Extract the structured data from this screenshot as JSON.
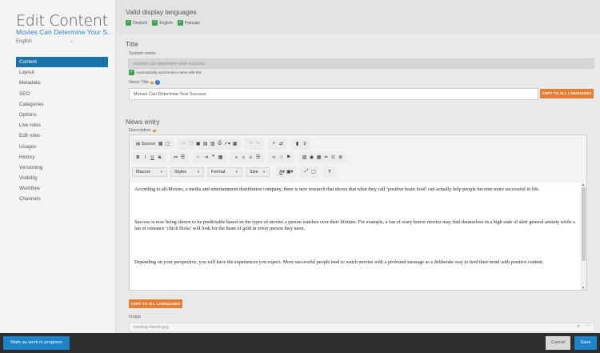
{
  "sidebar": {
    "title": "Edit Content",
    "subtitle": "Movies Can Determine Your S...",
    "language": "English",
    "nav": [
      "Content",
      "Layout",
      "Metadata",
      "SEO",
      "Categories",
      "Options",
      "Live roles",
      "Edit roles",
      "Usages",
      "History",
      "Versioning",
      "Visibility",
      "Workflow",
      "Channels"
    ],
    "active_index": 0
  },
  "languages": {
    "heading": "Valid display languages",
    "options": [
      {
        "label": "Deutsch",
        "checked": true
      },
      {
        "label": "English",
        "checked": true
      },
      {
        "label": "Français",
        "checked": true
      }
    ]
  },
  "title_section": {
    "heading": "Title",
    "system_name_label": "System name",
    "system_name_value": "movies-can-determine-your-success",
    "auto_sync_label": "Automatically synchronize name with title",
    "news_title_label": "News Title",
    "news_title_value": "Movies Can Determine Your Success",
    "copy_label": "COPY TO ALL LANGUAGES"
  },
  "news_entry": {
    "heading": "News entry",
    "description_label": "Description",
    "toolbar": {
      "source_label": "Source",
      "selects": [
        "Macros",
        "Styles",
        "Format",
        "Size"
      ]
    },
    "paragraphs": [
      "According to all-Movies, a media and entertainment distribution company, there is new research that shows that what they call ‘positive brain food’ can actually help people become more successful in life.",
      "Success is now being shown to be predictable based on the types of movies a person watches over their lifetime. For example, a fan of scary horror movies may find themselves in a high state of alert general anxiety while a fan of romance ‘chick flicks’ will look for the heart of gold in every person they meet.",
      "Depending on your perspective, you will have the experiences you expect. More successful people tend to watch movies with a profound message as a deliberate way to feed their mind with positive content."
    ],
    "copy_label": "COPY TO ALL LANGUAGES"
  },
  "image": {
    "label": "Image",
    "value": "holding-hands.jpg"
  },
  "bottom": {
    "wip_label": "Mark as work in progress",
    "cancel_label": "Cancel",
    "save_label": "Save"
  },
  "colors": {
    "accent": "#1d83c6",
    "active_nav": "#1a73a8",
    "copy_button": "#e67f36",
    "check": "#3aa34c",
    "bottom_bar": "#2e2e2e"
  }
}
